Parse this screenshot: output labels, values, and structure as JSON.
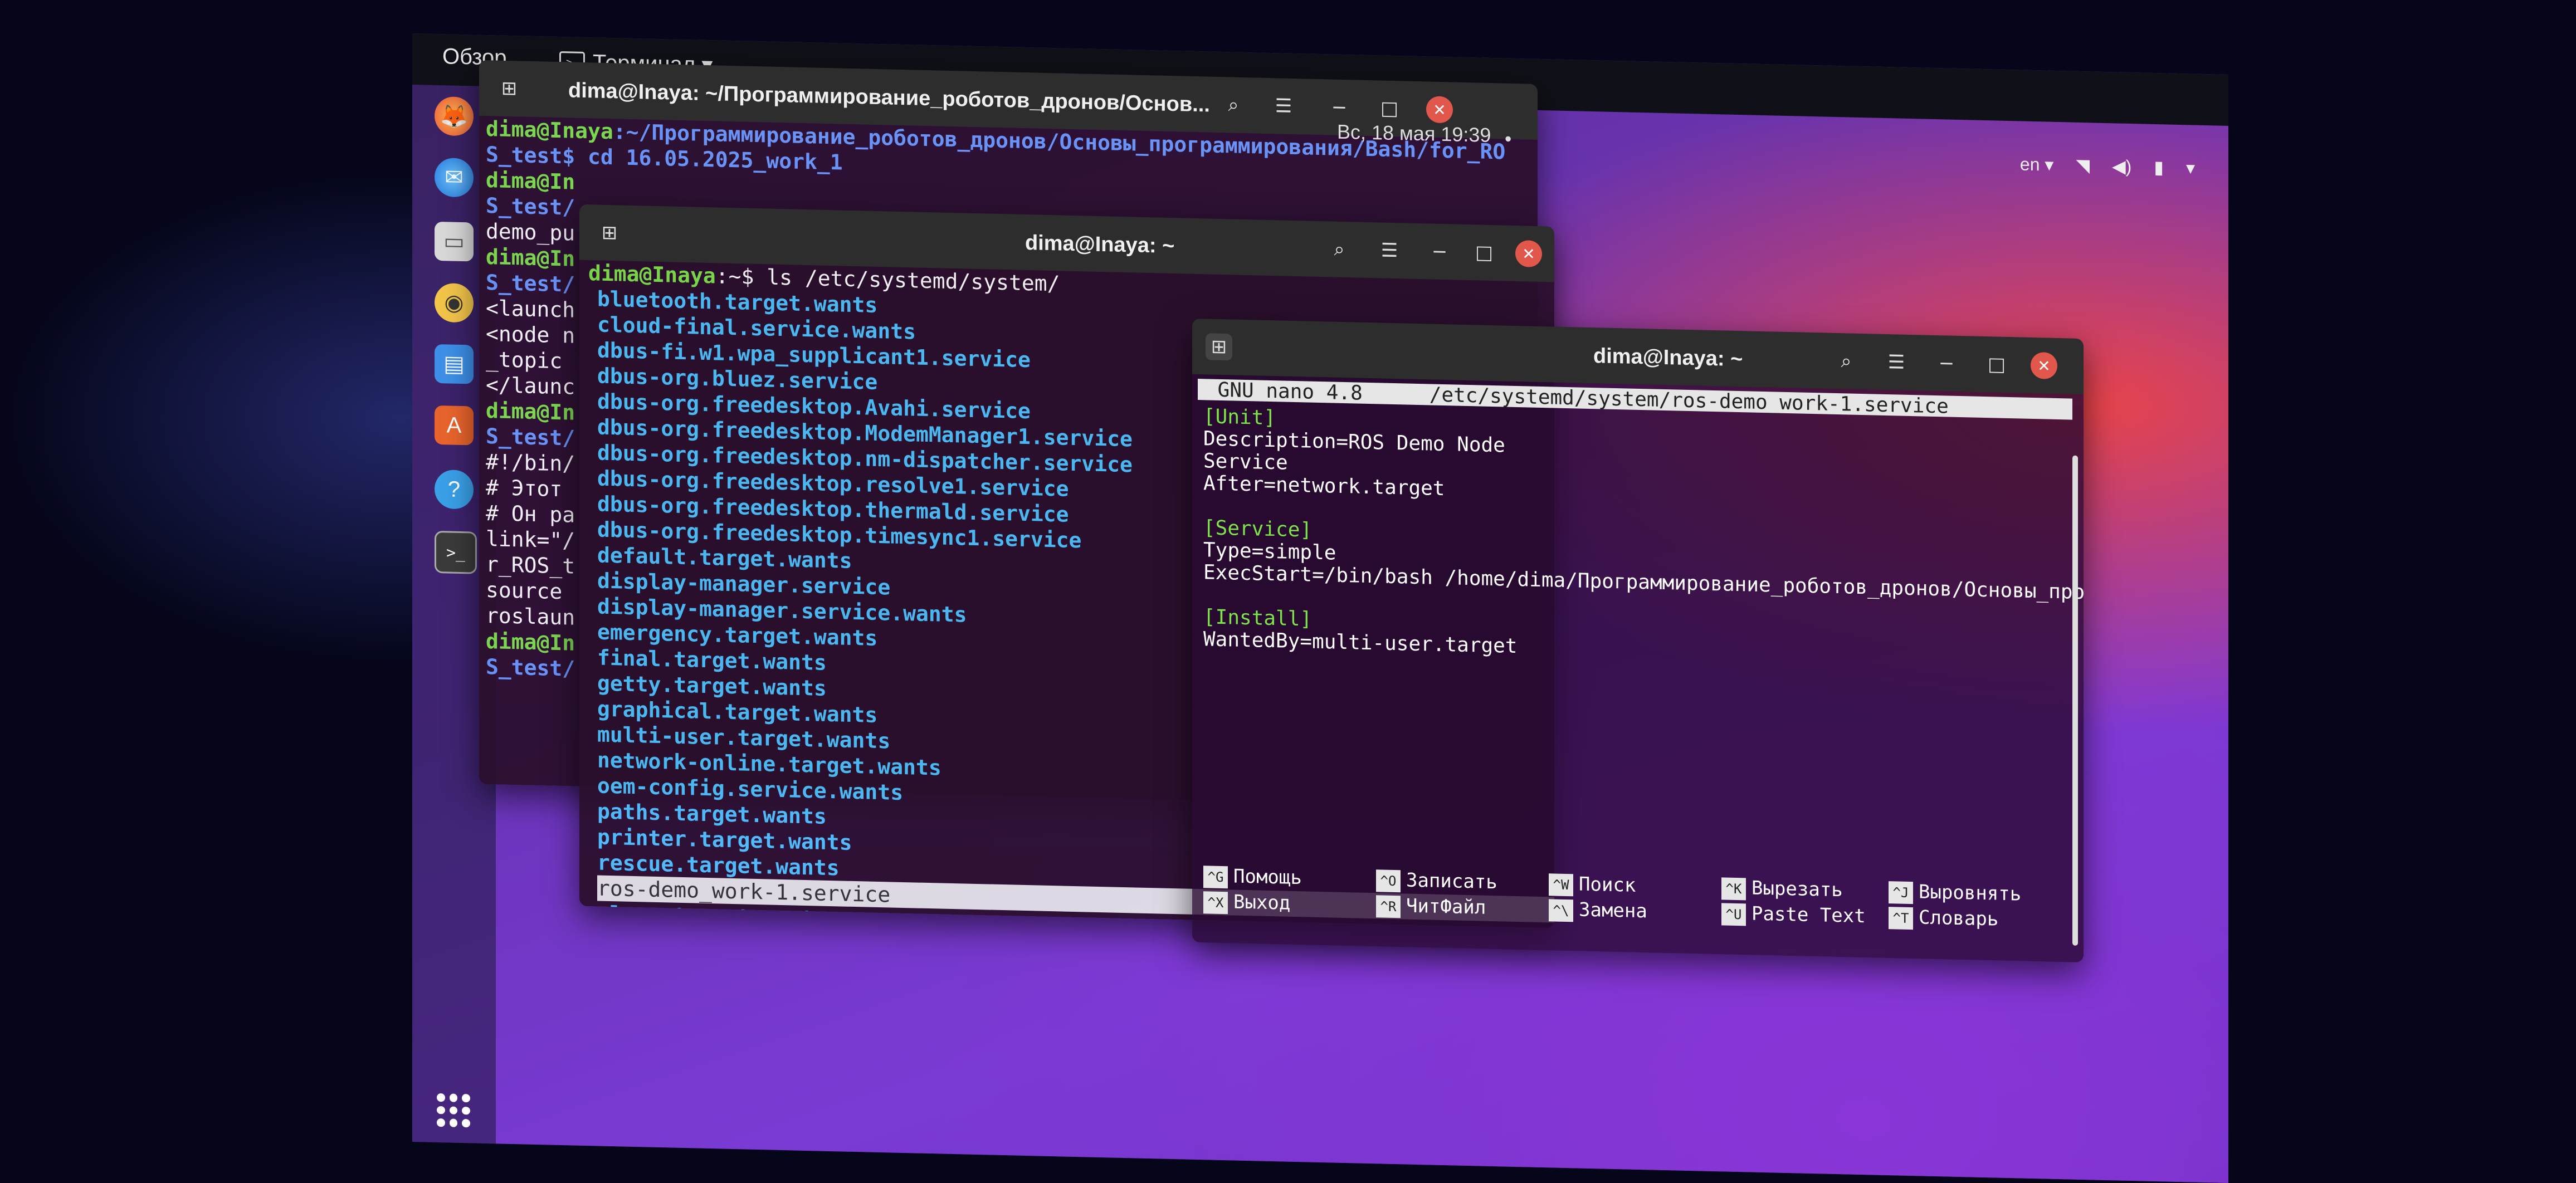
{
  "topbar": {
    "activities": "Обзор",
    "app_menu": "Терминал ▾",
    "clock": "Вс, 18 мая  19:39",
    "clock_dot": "●",
    "lang": "en ▾"
  },
  "window_back": {
    "title": "dima@Inaya: ~/Программирование_роботов_дронов/Основ...",
    "lines": [
      {
        "user": "dima@Inaya",
        "path": ":~/Программирование_роботов_дронов/Основы_программирования/Bash/for_RO"
      },
      {
        "text": "S_test$ cd 16.05.2025_work_1"
      },
      {
        "user": "dima@In",
        "path": ""
      },
      {
        "text": "S_test/"
      },
      {
        "text": "demo_pu"
      },
      {
        "user": "dima@In",
        "path": ""
      },
      {
        "text": "S_test/"
      },
      {
        "text": "<launch"
      },
      {
        "text": "<node n"
      },
      {
        "text": "_topic"
      },
      {
        "text": "</launc"
      },
      {
        "user": "dima@In",
        "path": ""
      },
      {
        "text": "S_test/"
      },
      {
        "text": "#!/bin/"
      },
      {
        "text": "# Этот"
      },
      {
        "text": "# Он ра"
      },
      {
        "text": ""
      },
      {
        "text": "link=\"/"
      },
      {
        "text": "r_ROS_t"
      },
      {
        "text": ""
      },
      {
        "text": "source"
      },
      {
        "text": "roslaun"
      },
      {
        "user": "dima@In",
        "path": ""
      },
      {
        "text": "S_test/"
      }
    ]
  },
  "window_mid": {
    "title": "dima@Inaya: ~",
    "prompt_user": "dima@Inaya",
    "prompt_rest": ":~$ ls /etc/systemd/system/",
    "entries": [
      "bluetooth.target.wants",
      "cloud-final.service.wants",
      "dbus-fi.w1.wpa_supplicant1.service",
      "dbus-org.bluez.service",
      "dbus-org.freedesktop.Avahi.service",
      "dbus-org.freedesktop.ModemManager1.service",
      "dbus-org.freedesktop.nm-dispatcher.service",
      "dbus-org.freedesktop.resolve1.service",
      "dbus-org.freedesktop.thermald.service",
      "dbus-org.freedesktop.timesync1.service",
      "default.target.wants",
      "display-manager.service",
      "display-manager.service.wants",
      "emergency.target.wants",
      "final.target.wants",
      "getty.target.wants",
      "graphical.target.wants",
      "multi-user.target.wants",
      "network-online.target.wants",
      "oem-config.service.wants",
      "paths.target.wants",
      "printer.target.wants",
      "rescue.target.wants",
      "ros-demo_work-1.service",
      "sleep.target.wants"
    ]
  },
  "window_nano": {
    "title": "dima@Inaya: ~",
    "header_left": " GNU nano 4.8",
    "header_file": "/etc/systemd/system/ros-demo_work-1.service",
    "lines": [
      {
        "text": "[Unit]",
        "section": true
      },
      {
        "text": "Description=ROS Demo Node",
        "section": false
      },
      {
        "text": "Service",
        "section": false
      },
      {
        "text": "After=network.target",
        "section": false
      },
      {
        "text": "",
        "section": false
      },
      {
        "text": "[Service]",
        "section": true
      },
      {
        "text": "Type=simple",
        "section": false
      },
      {
        "text": "ExecStart=/bin/bash /home/dima/Программирование_роботов_дронов/Основы_программ>",
        "section": false
      },
      {
        "text": "",
        "section": false
      },
      {
        "text": "[Install]",
        "section": true
      },
      {
        "text": "WantedBy=multi-user.target",
        "section": false
      }
    ],
    "shortcuts": [
      {
        "key": "^G",
        "label": "Помощь"
      },
      {
        "key": "^X",
        "label": "Выход"
      },
      {
        "key": "^O",
        "label": "Записать"
      },
      {
        "key": "^R",
        "label": "ЧитФайл"
      },
      {
        "key": "^W",
        "label": "Поиск"
      },
      {
        "key": "^\\",
        "label": "Замена"
      },
      {
        "key": "^K",
        "label": "Вырезать"
      },
      {
        "key": "^U",
        "label": "Paste Text"
      },
      {
        "key": "^J",
        "label": "Выровнять"
      },
      {
        "key": "^T",
        "label": "Словарь"
      }
    ]
  },
  "colors": {
    "prompt_user": "#7ee34a",
    "prompt_path": "#6b9bff",
    "dir_entry": "#4ec4ff",
    "close_button": "#e2574c"
  }
}
